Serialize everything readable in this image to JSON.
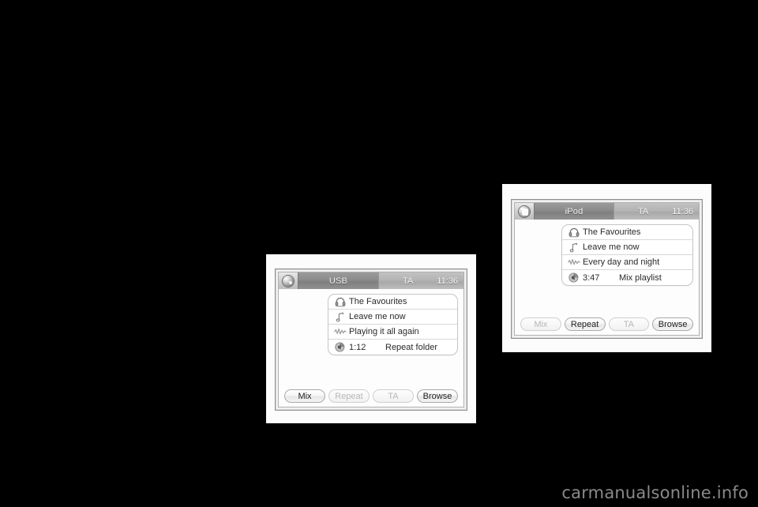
{
  "page": {
    "background_color": "#000000",
    "watermark": "carmanualsonline.info"
  },
  "screens": [
    {
      "id": "usb",
      "titlebar": {
        "home_icon": "sphere-home-icon",
        "source": "USB",
        "ta_label": "TA",
        "clock": "11:36"
      },
      "list": [
        {
          "icon": "headphones-icon",
          "text": "The Favourites"
        },
        {
          "icon": "music-note-icon",
          "text": "Leave me now"
        },
        {
          "icon": "waveform-icon",
          "text": "Playing it all again"
        },
        {
          "icon": "speaker-icon",
          "time": "1:12",
          "mode": "Repeat folder"
        }
      ],
      "buttons": [
        {
          "label": "Mix",
          "state": "enabled"
        },
        {
          "label": "Repeat",
          "state": "disabled"
        },
        {
          "label": "TA",
          "state": "disabled"
        },
        {
          "label": "Browse",
          "state": "enabled"
        }
      ]
    },
    {
      "id": "ipod",
      "titlebar": {
        "home_icon": "sphere-home-icon",
        "source": "iPod",
        "ta_label": "TA",
        "clock": "11:36"
      },
      "list": [
        {
          "icon": "headphones-icon",
          "text": "The Favourites"
        },
        {
          "icon": "music-note-icon",
          "text": "Leave me now"
        },
        {
          "icon": "waveform-icon",
          "text": "Every day and night"
        },
        {
          "icon": "speaker-icon",
          "time": "3:47",
          "mode": "Mix playlist"
        }
      ],
      "buttons": [
        {
          "label": "Mix",
          "state": "disabled"
        },
        {
          "label": "Repeat",
          "state": "enabled"
        },
        {
          "label": "TA",
          "state": "disabled"
        },
        {
          "label": "Browse",
          "state": "enabled"
        }
      ]
    }
  ]
}
